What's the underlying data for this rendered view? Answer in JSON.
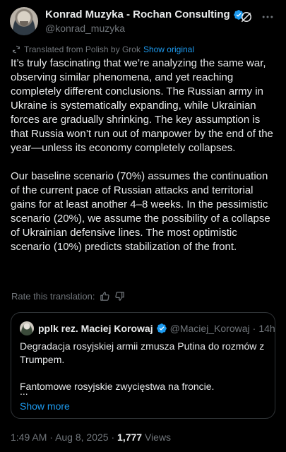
{
  "author": {
    "display_name": "Konrad Muzyka - Rochan Consulting",
    "handle": "@konrad_muzyka"
  },
  "translation": {
    "label": "Translated from Polish by Grok",
    "show_original": "Show original"
  },
  "tweet": {
    "paragraphs": [
      "It’s truly fascinating that we’re analyzing the same war, observing similar phenomena, and yet reaching completely different conclusions. The Russian army in Ukraine is systematically expanding, while Ukrainian forces are gradually shrinking. The key assumption is that Russia won’t run out of manpower by the end of the year—unless its economy completely collapses.",
      "Our baseline scenario (70%) assumes the continuation of the current pace of Russian attacks and territorial gains for at least another 4–8 weeks. In the pessimistic scenario (20%), we assume the possibility of a collapse of Ukrainian defensive lines. The most optimistic scenario (10%) predicts stabilization of the front."
    ]
  },
  "rate": {
    "label": "Rate this translation:"
  },
  "quote": {
    "display_name": "pplk rez. Maciej Korowaj",
    "handle": "@Maciej_Korowaj",
    "separator": "·",
    "time": "14h",
    "paragraphs": [
      "Degradacja rosyjskiej armii zmusza Putina do rozmów z Trumpem.",
      "Fantomowe rosyjskie zwycięstwa na froncie."
    ],
    "ellipsis": "...",
    "show_more": "Show more"
  },
  "meta": {
    "time": "1:49 AM",
    "separator": "·",
    "date": "Aug 8, 2025",
    "views_count": "1,777",
    "views_label": "Views"
  },
  "colors": {
    "background": "#000000",
    "text": "#e7e9ea",
    "secondary": "#71767b",
    "accent": "#1d9bf0",
    "border": "#2f3336"
  },
  "icons": [
    "verified-badge-icon",
    "grok-icon",
    "more-icon",
    "translate-icon",
    "thumbs-up-icon",
    "thumbs-down-icon"
  ]
}
